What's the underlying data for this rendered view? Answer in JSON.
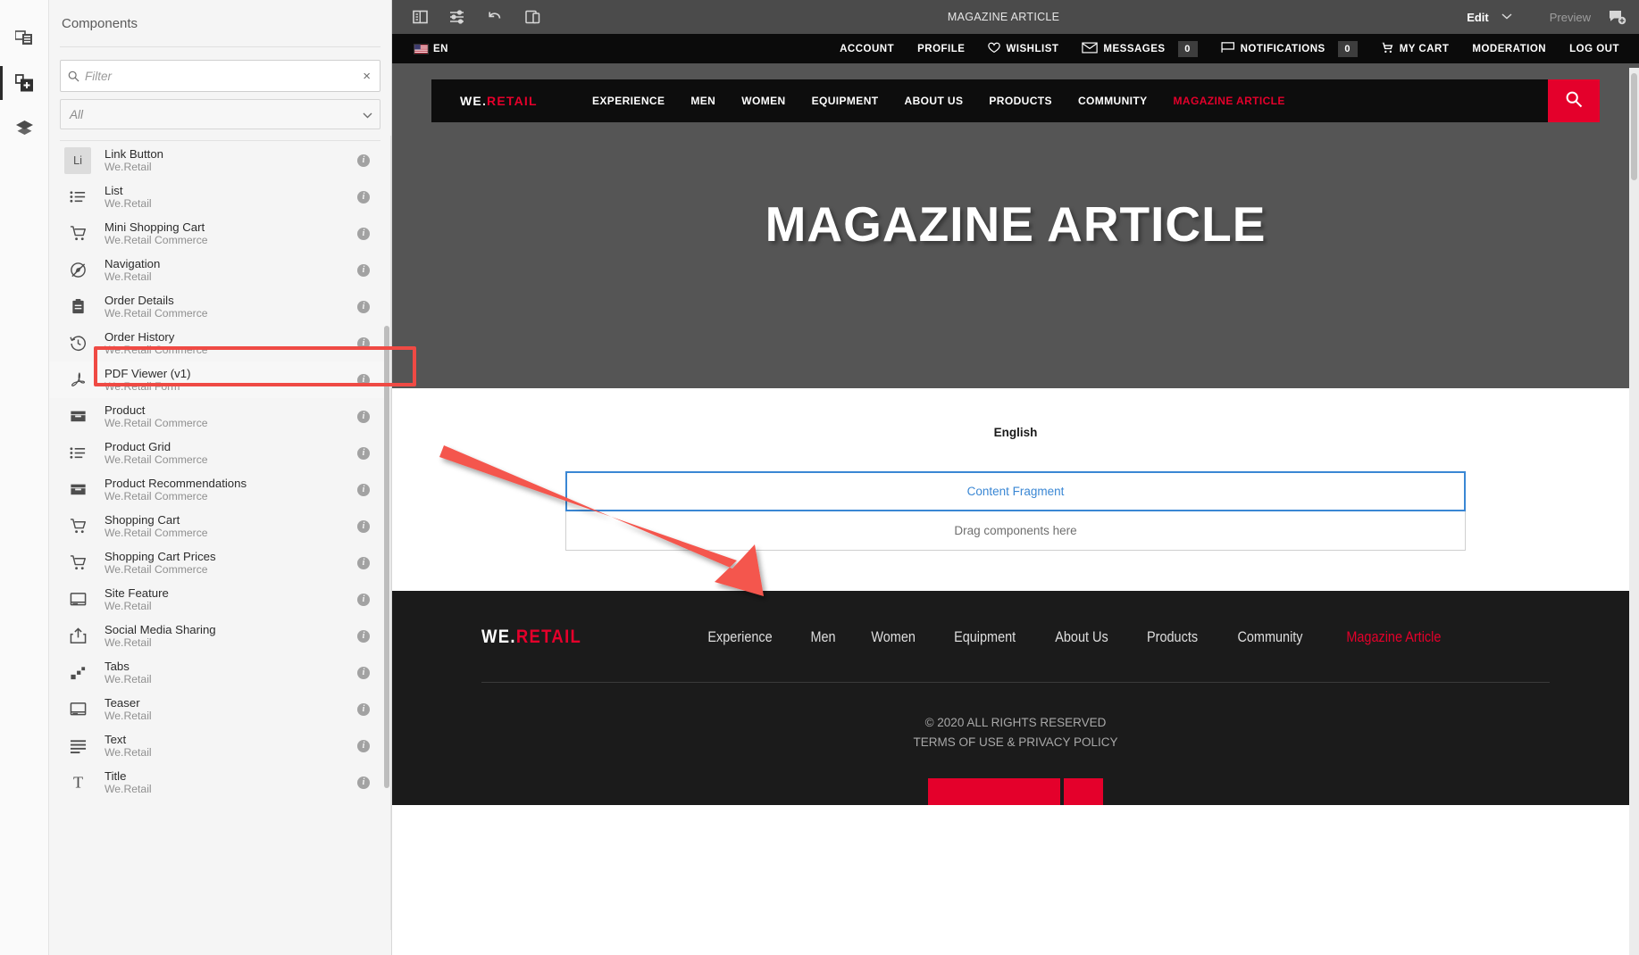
{
  "rail": {
    "items": [
      {
        "name": "assets-icon",
        "label": "Assets"
      },
      {
        "name": "components-icon",
        "label": "Components"
      },
      {
        "name": "layers-icon",
        "label": "Content Tree"
      }
    ]
  },
  "panel": {
    "title": "Components",
    "filter": {
      "placeholder": "Filter",
      "value": "",
      "clear_label": "×"
    },
    "group_select": {
      "value": "All",
      "chevron": "⌄"
    },
    "info_glyph": "i",
    "components": [
      {
        "name": "Link Button",
        "group": "We.Retail",
        "icon": "link-button-icon",
        "icon_text": "Li"
      },
      {
        "name": "List",
        "group": "We.Retail",
        "icon": "list-icon"
      },
      {
        "name": "Mini Shopping Cart",
        "group": "We.Retail Commerce",
        "icon": "cart-icon"
      },
      {
        "name": "Navigation",
        "group": "We.Retail",
        "icon": "compass-icon"
      },
      {
        "name": "Order Details",
        "group": "We.Retail Commerce",
        "icon": "clipboard-icon"
      },
      {
        "name": "Order History",
        "group": "We.Retail Commerce",
        "icon": "clock-icon"
      },
      {
        "name": "PDF Viewer (v1)",
        "group": "We.Retail Form",
        "icon": "pdf-icon",
        "highlighted": true
      },
      {
        "name": "Product",
        "group": "We.Retail Commerce",
        "icon": "archive-icon"
      },
      {
        "name": "Product Grid",
        "group": "We.Retail Commerce",
        "icon": "list-icon"
      },
      {
        "name": "Product Recommendations",
        "group": "We.Retail Commerce",
        "icon": "archive-icon"
      },
      {
        "name": "Shopping Cart",
        "group": "We.Retail Commerce",
        "icon": "cart-icon"
      },
      {
        "name": "Shopping Cart Prices",
        "group": "We.Retail Commerce",
        "icon": "cart-icon"
      },
      {
        "name": "Site Feature",
        "group": "We.Retail",
        "icon": "browser-icon"
      },
      {
        "name": "Social Media Sharing",
        "group": "We.Retail",
        "icon": "share-icon"
      },
      {
        "name": "Tabs",
        "group": "We.Retail",
        "icon": "tabs-icon"
      },
      {
        "name": "Teaser",
        "group": "We.Retail",
        "icon": "browser-icon"
      },
      {
        "name": "Text",
        "group": "We.Retail",
        "icon": "text-icon"
      },
      {
        "name": "Title",
        "group": "We.Retail",
        "icon": "title-icon"
      }
    ]
  },
  "toolbar": {
    "title": "MAGAZINE ARTICLE",
    "sidebar_toggle": "side-panel-icon",
    "page_info": "page-properties-icon",
    "undo": "undo-icon",
    "emulator": "device-emulator-icon",
    "mode": "Edit",
    "mode_chevron": "⌄",
    "preview": "Preview",
    "annotate": "annotate-icon"
  },
  "site": {
    "topbar": {
      "language": "EN",
      "flag": "us-flag-icon",
      "links": [
        {
          "label": "ACCOUNT"
        },
        {
          "label": "PROFILE"
        },
        {
          "label": "WISHLIST",
          "icon": "heart-icon"
        },
        {
          "label": "MESSAGES",
          "icon": "envelope-icon",
          "badge": "0"
        },
        {
          "label": "NOTIFICATIONS",
          "icon": "flag-icon",
          "badge": "0"
        },
        {
          "label": "MY CART",
          "icon": "cart-icon"
        },
        {
          "label": "MODERATION"
        },
        {
          "label": "LOG OUT"
        }
      ]
    },
    "nav": {
      "brand_primary": "WE.",
      "brand_accent": "RETAIL",
      "links": [
        {
          "label": "EXPERIENCE",
          "active": false
        },
        {
          "label": "MEN",
          "active": false
        },
        {
          "label": "WOMEN",
          "active": false
        },
        {
          "label": "EQUIPMENT",
          "active": false
        },
        {
          "label": "ABOUT US",
          "active": false
        },
        {
          "label": "PRODUCTS",
          "active": false
        },
        {
          "label": "COMMUNITY",
          "active": false
        },
        {
          "label": "MAGAZINE ARTICLE",
          "active": true
        }
      ],
      "search_icon": "search-icon"
    },
    "hero": {
      "title": "MAGAZINE ARTICLE"
    },
    "content": {
      "language_label": "English",
      "content_fragment_placeholder": "Content Fragment",
      "drag_placeholder": "Drag components here"
    },
    "footer": {
      "brand_primary": "WE.",
      "brand_accent": "RETAIL",
      "links": [
        {
          "label": "Experience",
          "active": false
        },
        {
          "label": "Men",
          "active": false
        },
        {
          "label": "Women",
          "active": false
        },
        {
          "label": "Equipment",
          "active": false
        },
        {
          "label": "About Us",
          "active": false
        },
        {
          "label": "Products",
          "active": false
        },
        {
          "label": "Community",
          "active": false
        },
        {
          "label": "Magazine Article",
          "active": true
        }
      ],
      "copyright": "© 2020 ALL RIGHTS RESERVED",
      "terms": "TERMS OF USE & PRIVACY POLICY"
    }
  },
  "colors": {
    "accent_red": "#e4002b",
    "annotation_red": "#ef4a44",
    "selection_blue": "#3a87d4",
    "toolbar_gray": "#4b4b4b",
    "hero_gray": "#555555",
    "footer_dark": "#1b1b1b"
  }
}
